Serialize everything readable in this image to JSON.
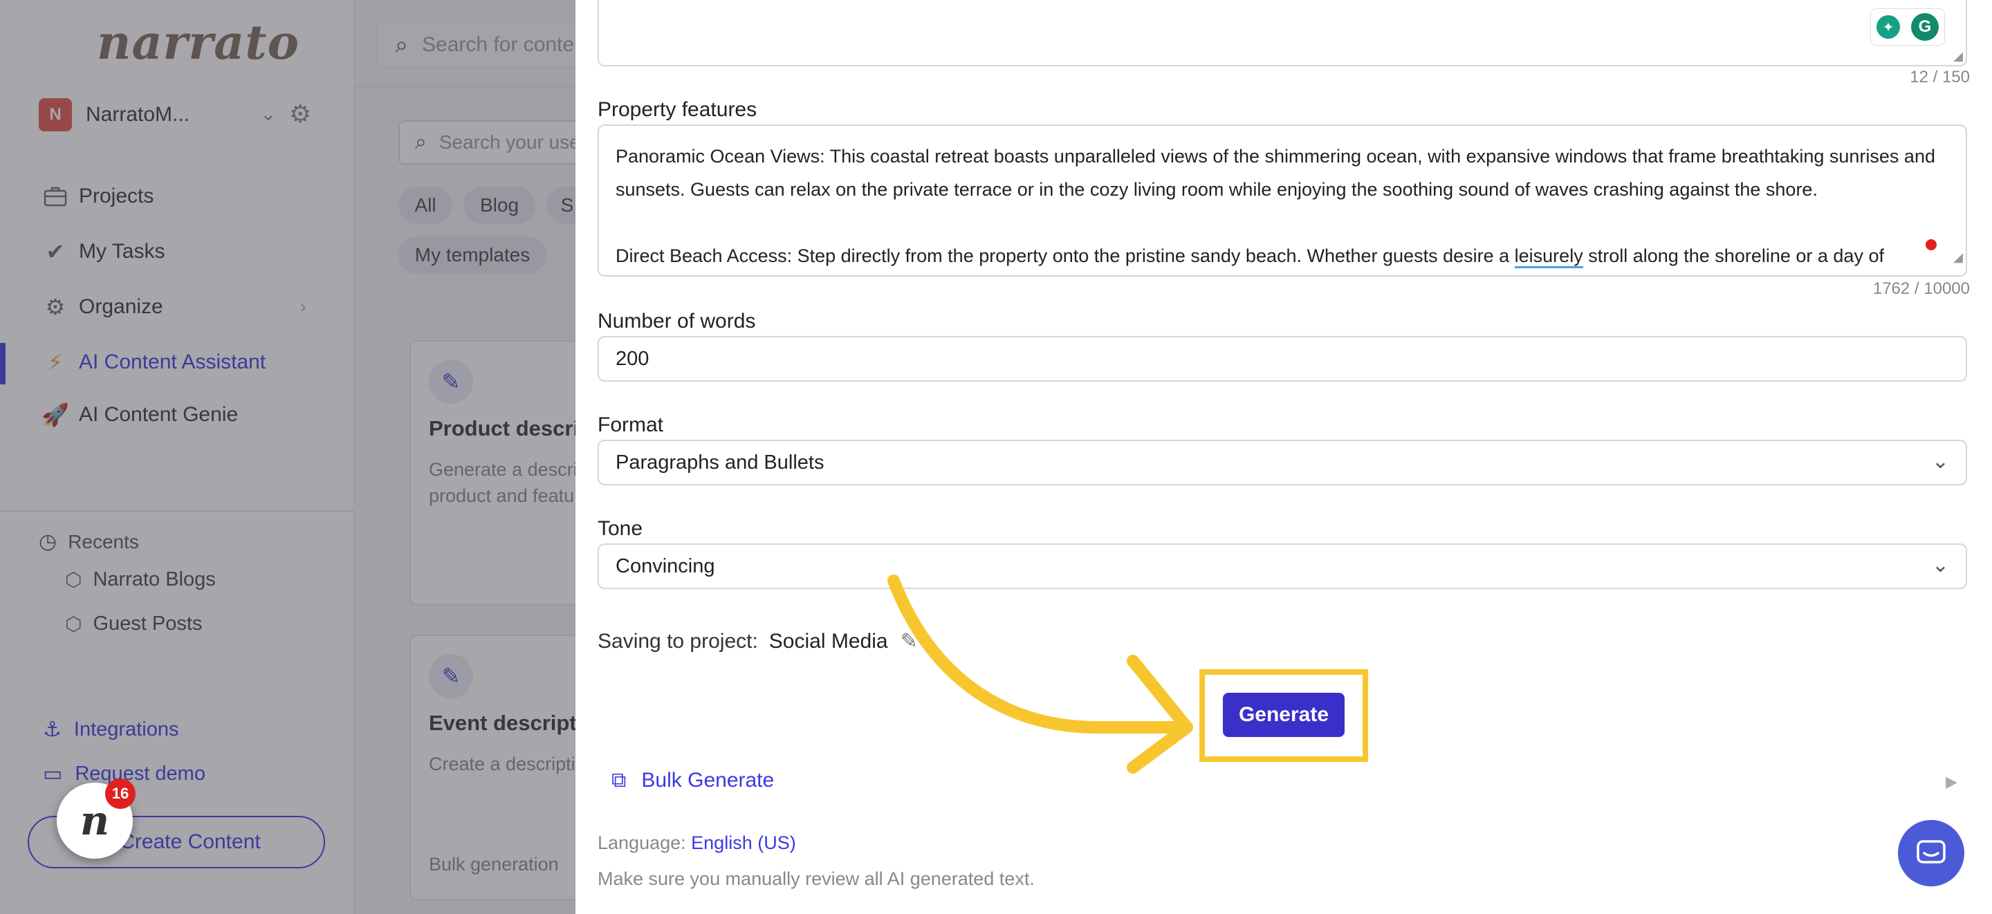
{
  "sidebar": {
    "logo": "narrato",
    "workspace": {
      "initial": "N",
      "name": "NarratoM..."
    },
    "nav": [
      {
        "label": "Projects",
        "icon": "briefcase-icon"
      },
      {
        "label": "My Tasks",
        "icon": "checkmark-icon"
      },
      {
        "label": "Organize",
        "icon": "gears-icon"
      },
      {
        "label": "AI Content Assistant",
        "icon": "lightning-icon"
      },
      {
        "label": "AI Content Genie",
        "icon": "rocket-icon"
      }
    ],
    "recents_label": "Recents",
    "recents": [
      "Narrato Blogs",
      "Guest Posts"
    ],
    "links": [
      {
        "label": "Integrations",
        "icon": "anchor-icon"
      },
      {
        "label": "Request demo",
        "icon": "monitor-icon"
      }
    ],
    "create_label": "Create Content",
    "notification_count": "16",
    "bubble_letter": "n"
  },
  "middle": {
    "search_placeholder": "Search for content",
    "inner_search_placeholder": "Search your use cases",
    "filters": [
      "All",
      "Blog",
      "S",
      "My templates"
    ],
    "cards": [
      {
        "title": "Product description",
        "desc": "Generate a description for a product and features"
      },
      {
        "title": "Event description",
        "desc": "Create a description",
        "footer": "Bulk generation"
      }
    ]
  },
  "form": {
    "top_counter": "12 / 150",
    "property_label": "Property features",
    "property_text": {
      "p1": "Panoramic Ocean Views: This coastal retreat boasts unparalleled views of the shimmering ocean, with expansive windows that frame breathtaking sunrises and sunsets. Guests can relax on the private terrace or in the cozy living room while enjoying the soothing sound of waves crashing against the shore.",
      "p2a": "Direct Beach Access: Step directly from the property onto the pristine sandy beach. Whether guests desire a ",
      "p2b": "leisurely",
      "p2c": " stroll along the shoreline or a day of"
    },
    "property_counter": "1762 / 10000",
    "words_label": "Number of words",
    "words_value": "200",
    "format_label": "Format",
    "format_value": "Paragraphs and Bullets",
    "tone_label": "Tone",
    "tone_value": "Convincing",
    "saving_label": "Saving to project:",
    "saving_project": "Social Media",
    "generate_label": "Generate",
    "bulk_label": "Bulk Generate",
    "language_label": "Language:",
    "language_value": "English (US)",
    "review_note": "Make sure you manually review all AI generated text."
  },
  "colors": {
    "accent": "#3b3ae0",
    "button": "#3b2fc9",
    "highlight": "#f7c62f"
  }
}
